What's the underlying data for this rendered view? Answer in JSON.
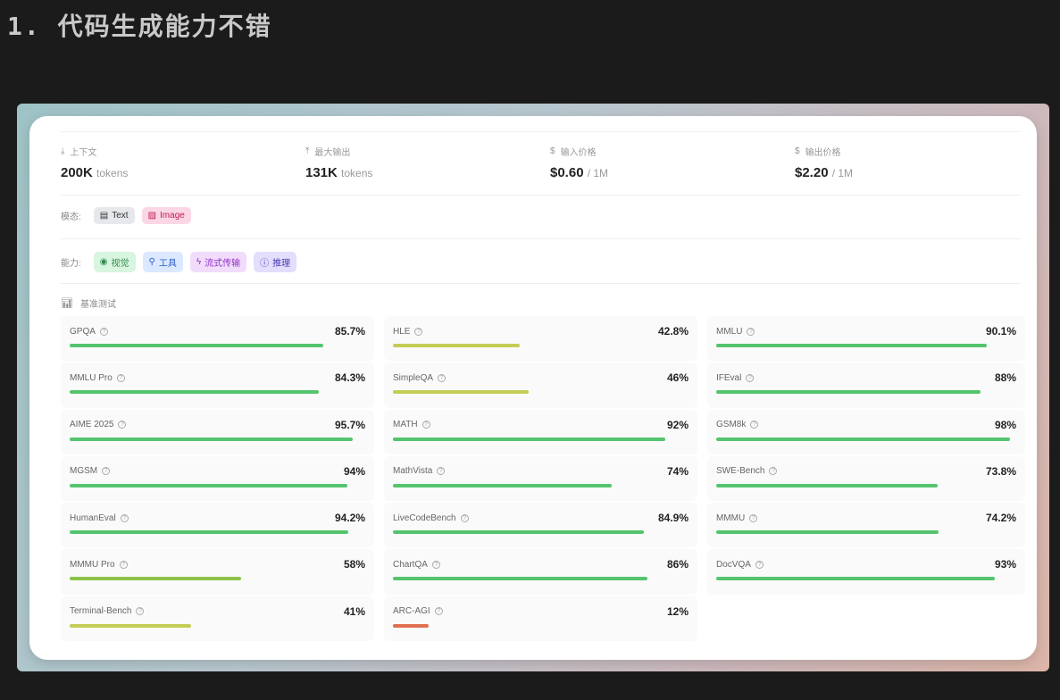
{
  "title": "1. 代码生成能力不错",
  "stats": [
    {
      "icon": "download-icon",
      "glyph": "⤓",
      "label": "上下文",
      "value": "200K",
      "unit": "tokens"
    },
    {
      "icon": "upload-icon",
      "glyph": "⤒",
      "label": "最大输出",
      "value": "131K",
      "unit": "tokens"
    },
    {
      "icon": "dollar-icon",
      "glyph": "$",
      "label": "输入价格",
      "value": "$0.60",
      "unit": "/ 1M"
    },
    {
      "icon": "dollar-icon",
      "glyph": "$",
      "label": "输出价格",
      "value": "$2.20",
      "unit": "/ 1M"
    }
  ],
  "modality": {
    "label": "模态:",
    "tags": [
      {
        "glyph": "▤",
        "text": "Text",
        "bg": "#e6e8ec",
        "fg": "#333"
      },
      {
        "glyph": "▨",
        "text": "Image",
        "bg": "#fbd7e6",
        "fg": "#c2185b"
      }
    ]
  },
  "capability": {
    "label": "能力:",
    "tags": [
      {
        "glyph": "◉",
        "text": "视觉",
        "bg": "#d8f5df",
        "fg": "#2e8b4a"
      },
      {
        "glyph": "⚲",
        "text": "工具",
        "bg": "#dbe8ff",
        "fg": "#2c5fc9"
      },
      {
        "glyph": "ϟ",
        "text": "流式传输",
        "bg": "#f1dcfb",
        "fg": "#9333c9"
      },
      {
        "glyph": "ⓘ",
        "text": "推理",
        "bg": "#e2defc",
        "fg": "#4b3bb5"
      }
    ]
  },
  "benchmark_title": "基准测试",
  "benchmarks": [
    {
      "name": "GPQA",
      "label": "85.7%",
      "value": 85.7
    },
    {
      "name": "HLE",
      "label": "42.8%",
      "value": 42.8
    },
    {
      "name": "MMLU",
      "label": "90.1%",
      "value": 90.1
    },
    {
      "name": "MMLU Pro",
      "label": "84.3%",
      "value": 84.3
    },
    {
      "name": "SimpleQA",
      "label": "46%",
      "value": 46
    },
    {
      "name": "IFEval",
      "label": "88%",
      "value": 88
    },
    {
      "name": "AIME 2025",
      "label": "95.7%",
      "value": 95.7
    },
    {
      "name": "MATH",
      "label": "92%",
      "value": 92
    },
    {
      "name": "GSM8k",
      "label": "98%",
      "value": 98
    },
    {
      "name": "MGSM",
      "label": "94%",
      "value": 94
    },
    {
      "name": "MathVista",
      "label": "74%",
      "value": 74
    },
    {
      "name": "SWE-Bench",
      "label": "73.8%",
      "value": 73.8
    },
    {
      "name": "HumanEval",
      "label": "94.2%",
      "value": 94.2
    },
    {
      "name": "LiveCodeBench",
      "label": "84.9%",
      "value": 84.9
    },
    {
      "name": "MMMU",
      "label": "74.2%",
      "value": 74.2
    },
    {
      "name": "MMMU Pro",
      "label": "58%",
      "value": 58
    },
    {
      "name": "ChartQA",
      "label": "86%",
      "value": 86
    },
    {
      "name": "DocVQA",
      "label": "93%",
      "value": 93
    },
    {
      "name": "Terminal-Bench",
      "label": "41%",
      "value": 41
    },
    {
      "name": "ARC-AGI",
      "label": "12%",
      "value": 12
    }
  ],
  "colors": {
    "high": "#55c46e",
    "mid": "#8bc34a",
    "low": "#c4cd55",
    "bad": "#e07050"
  }
}
